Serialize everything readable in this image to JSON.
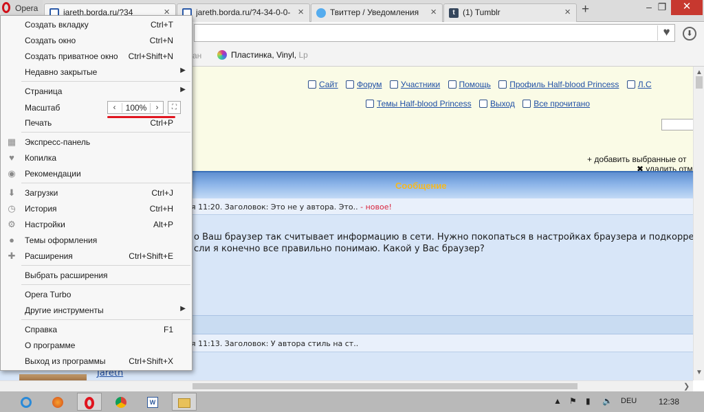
{
  "browser": {
    "opera_label": "Opera",
    "tabs": [
      {
        "title": "jareth.borda.ru/?34"
      },
      {
        "title": "jareth.borda.ru/?4-34-0-0-"
      },
      {
        "title": "Твиттер / Уведомления"
      },
      {
        "title": "(1) Tumblr"
      }
    ],
    "new_tab_label": "+",
    "win_min": "–",
    "win_max": "❐",
    "win_close": "✕"
  },
  "bookmarks": {
    "faded_label": "ан",
    "vinyl_label": "Пластинка, Vinyl,",
    "vinyl_suffix": "Lp"
  },
  "menu": {
    "items": [
      {
        "label": "Создать вкладку",
        "shortcut": "Ctrl+T"
      },
      {
        "label": "Создать окно",
        "shortcut": "Ctrl+N"
      },
      {
        "label": "Создать приватное окно",
        "shortcut": "Ctrl+Shift+N"
      },
      {
        "label": "Недавно закрытые",
        "shortcut": ""
      },
      {
        "label": "Страница",
        "shortcut": ""
      },
      {
        "label": "Масштаб",
        "shortcut": ""
      },
      {
        "label": "Печать",
        "shortcut": "Ctrl+P"
      },
      {
        "label": "Экспресс-панель",
        "shortcut": ""
      },
      {
        "label": "Копилка",
        "shortcut": ""
      },
      {
        "label": "Рекомендации",
        "shortcut": ""
      },
      {
        "label": "Загрузки",
        "shortcut": "Ctrl+J"
      },
      {
        "label": "История",
        "shortcut": "Ctrl+H"
      },
      {
        "label": "Настройки",
        "shortcut": "Alt+P"
      },
      {
        "label": "Темы оформления",
        "shortcut": ""
      },
      {
        "label": "Расширения",
        "shortcut": "Ctrl+Shift+E"
      },
      {
        "label": "Выбрать расширения",
        "shortcut": ""
      },
      {
        "label": "Opera Turbo",
        "shortcut": ""
      },
      {
        "label": "Другие инструменты",
        "shortcut": ""
      },
      {
        "label": "Справка",
        "shortcut": "F1"
      },
      {
        "label": "О программе",
        "shortcut": ""
      },
      {
        "label": "Выход из программы",
        "shortcut": "Ctrl+Shift+X"
      }
    ],
    "zoom_value": "100%"
  },
  "forum": {
    "nav_row1": [
      "Сайт",
      "Форум",
      "Участники",
      "Помощь",
      "Профиль Half-blood Princess",
      "Л.С"
    ],
    "nav_row2": [
      "Темы Half-blood Princess",
      "Выход",
      "Все прочитано"
    ],
    "add_selected": "+ добавить выбранные от",
    "delete_selected": "✖ удалить отм",
    "message_header": "Сообщение",
    "msg1_info": "я 11:20. Заголовок: Это не у автора. Это..",
    "msg1_new": " - новое!",
    "msg1_line1": "о Ваш браузер так считывает информацию в сети. Нужно покопаться в настройках браузера и подкорре",
    "msg1_line2": "сли я конечно все правильно понимаю. Какой у Вас браузер?",
    "msg2_info": "я 11:13. Заголовок: У автора стиль на ст..",
    "msg2_author": "Jareth"
  },
  "taskbar": {
    "lang": "DEU",
    "clock": "12:38"
  }
}
